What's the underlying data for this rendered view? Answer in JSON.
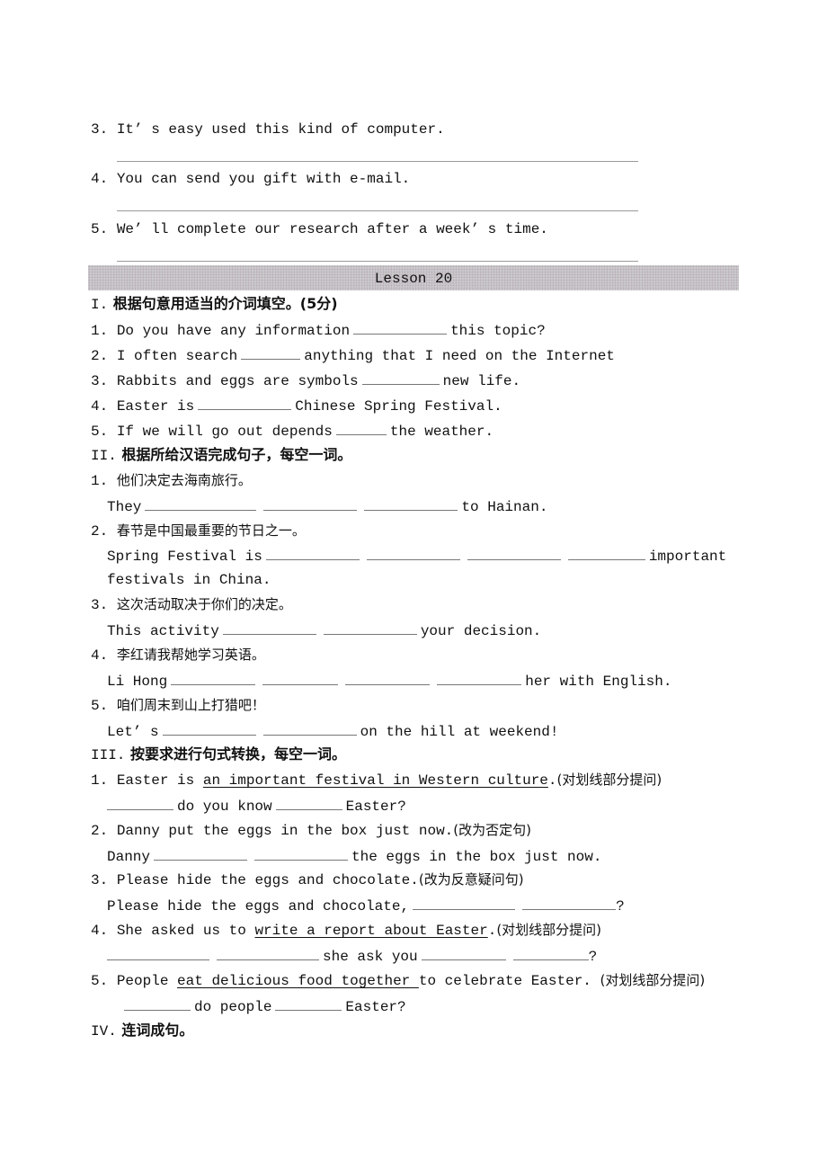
{
  "prev_exercise": {
    "items": [
      {
        "num": "3.",
        "text": "It’ s easy used this kind of computer."
      },
      {
        "num": "4.",
        "text": "You can send you gift with e-mail."
      },
      {
        "num": "5.",
        "text": "We’ ll complete our research after a week’ s time."
      }
    ]
  },
  "lesson": {
    "title": "Lesson 20"
  },
  "section1": {
    "roman": "I.",
    "heading": "根据句意用适当的介词填空。(5分)",
    "items": [
      {
        "num": "1.",
        "before": "Do you have any information",
        "after": "this topic?"
      },
      {
        "num": "2.",
        "before": "I often search",
        "after": "anything that I need on the Internet"
      },
      {
        "num": "3.",
        "before": "Rabbits and eggs are symbols",
        "after": "new life."
      },
      {
        "num": "4.",
        "before": "Easter is",
        "after": "Chinese Spring Festival."
      },
      {
        "num": "5.",
        "before": "If we will go out depends",
        "after": "the weather."
      }
    ]
  },
  "section2": {
    "roman": "II.",
    "heading": "根据所给汉语完成句子，每空一词。",
    "items": [
      {
        "num": "1.",
        "cn": "他们决定去海南旅行。",
        "before": "They",
        "after": "to Hainan."
      },
      {
        "num": "2.",
        "cn": "春节是中国最重要的节日之一。",
        "before": "Spring Festival is",
        "after": "important",
        "cont": "festivals in China."
      },
      {
        "num": "3.",
        "cn": "这次活动取决于你们的决定。",
        "before": "This activity",
        "after": "your decision."
      },
      {
        "num": "4.",
        "cn": "李红请我帮她学习英语。",
        "before": "Li Hong",
        "after": "her with English."
      },
      {
        "num": "5.",
        "cn": "咱们周末到山上打猎吧！",
        "before": "Let’ s",
        "after": "on the hill at weekend!"
      }
    ]
  },
  "section3": {
    "roman": "III.",
    "heading": "按要求进行句式转换，每空一词。",
    "items": [
      {
        "num": "1.",
        "pre": "Easter is",
        "underlined": "an important festival in Western culture",
        "post": ".",
        "instr": "(对划线部分提问)",
        "answer_mid": "do you know",
        "answer_end": "Easter?"
      },
      {
        "num": "2.",
        "pre": "Danny put the eggs in the box just now.",
        "instr": "(改为否定句)",
        "answer_start": "Danny",
        "answer_end": "the eggs in the box just now."
      },
      {
        "num": "3.",
        "pre": "Please hide the eggs and chocolate.",
        "instr": "(改为反意疑问句)",
        "answer_start": "Please hide the eggs and chocolate,",
        "answer_end": "?"
      },
      {
        "num": "4.",
        "pre": "She asked us to",
        "underlined": "write a report about Easter",
        "post": ".",
        "instr": "(对划线部分提问)",
        "answer_mid": "she ask you",
        "answer_end": "?"
      },
      {
        "num": "5.",
        "pre": "People",
        "underlined": "eat delicious food together ",
        "post": "to celebrate Easter.",
        "instr": "(对划线部分提问)",
        "answer_mid": "do people",
        "answer_end": "Easter?"
      }
    ]
  },
  "section4": {
    "roman": "IV.",
    "heading": "连词成句。"
  }
}
